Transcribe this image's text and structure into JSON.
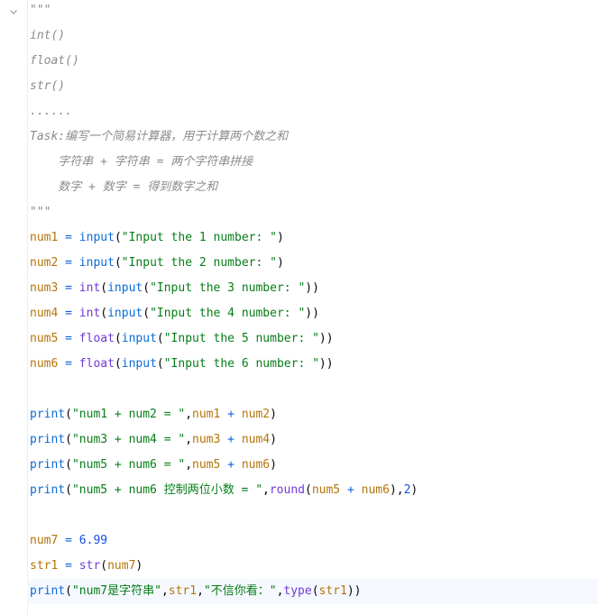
{
  "editor": {
    "lines": [
      {
        "tokens": [
          {
            "t": "\"\"\"",
            "c": "cmt"
          }
        ]
      },
      {
        "tokens": [
          {
            "t": "int()",
            "c": "cmt"
          }
        ]
      },
      {
        "tokens": [
          {
            "t": "float()",
            "c": "cmt"
          }
        ]
      },
      {
        "tokens": [
          {
            "t": "str()",
            "c": "cmt"
          }
        ]
      },
      {
        "tokens": [
          {
            "t": "......",
            "c": "cmt"
          }
        ]
      },
      {
        "tokens": [
          {
            "t": "Task:编写一个简易计算器，用于计算两个数之和",
            "c": "cmt"
          }
        ]
      },
      {
        "tokens": [
          {
            "t": "    字符串 + 字符串 = 两个字符串拼接",
            "c": "cmt"
          }
        ]
      },
      {
        "tokens": [
          {
            "t": "    数字 + 数字 = 得到数字之和",
            "c": "cmt"
          }
        ]
      },
      {
        "tokens": [
          {
            "t": "\"\"\"",
            "c": "cmt"
          }
        ]
      },
      {
        "tokens": [
          {
            "t": "num1",
            "c": "var"
          },
          {
            "t": " = ",
            "c": "op"
          },
          {
            "t": "input",
            "c": "bi"
          },
          {
            "t": "(",
            "c": "pun"
          },
          {
            "t": "\"Input the 1 number: \"",
            "c": "str"
          },
          {
            "t": ")",
            "c": "pun"
          }
        ]
      },
      {
        "tokens": [
          {
            "t": "num2",
            "c": "var"
          },
          {
            "t": " = ",
            "c": "op"
          },
          {
            "t": "input",
            "c": "bi"
          },
          {
            "t": "(",
            "c": "pun"
          },
          {
            "t": "\"Input the 2 number: \"",
            "c": "str"
          },
          {
            "t": ")",
            "c": "pun"
          }
        ]
      },
      {
        "tokens": [
          {
            "t": "num3",
            "c": "var"
          },
          {
            "t": " = ",
            "c": "op"
          },
          {
            "t": "int",
            "c": "fn"
          },
          {
            "t": "(",
            "c": "pun"
          },
          {
            "t": "input",
            "c": "bi"
          },
          {
            "t": "(",
            "c": "pun"
          },
          {
            "t": "\"Input the 3 number: \"",
            "c": "str"
          },
          {
            "t": "))",
            "c": "pun"
          }
        ]
      },
      {
        "tokens": [
          {
            "t": "num4",
            "c": "var"
          },
          {
            "t": " = ",
            "c": "op"
          },
          {
            "t": "int",
            "c": "fn"
          },
          {
            "t": "(",
            "c": "pun"
          },
          {
            "t": "input",
            "c": "bi"
          },
          {
            "t": "(",
            "c": "pun"
          },
          {
            "t": "\"Input the 4 number: \"",
            "c": "str"
          },
          {
            "t": "))",
            "c": "pun"
          }
        ]
      },
      {
        "tokens": [
          {
            "t": "num5",
            "c": "var"
          },
          {
            "t": " = ",
            "c": "op"
          },
          {
            "t": "float",
            "c": "fn"
          },
          {
            "t": "(",
            "c": "pun"
          },
          {
            "t": "input",
            "c": "bi"
          },
          {
            "t": "(",
            "c": "pun"
          },
          {
            "t": "\"Input the 5 number: \"",
            "c": "str"
          },
          {
            "t": "))",
            "c": "pun"
          }
        ]
      },
      {
        "tokens": [
          {
            "t": "num6",
            "c": "var"
          },
          {
            "t": " = ",
            "c": "op"
          },
          {
            "t": "float",
            "c": "fn"
          },
          {
            "t": "(",
            "c": "pun"
          },
          {
            "t": "input",
            "c": "bi"
          },
          {
            "t": "(",
            "c": "pun"
          },
          {
            "t": "\"Input the 6 number: \"",
            "c": "str"
          },
          {
            "t": "))",
            "c": "pun"
          }
        ]
      },
      {
        "tokens": []
      },
      {
        "tokens": [
          {
            "t": "print",
            "c": "kw-print"
          },
          {
            "t": "(",
            "c": "pun"
          },
          {
            "t": "\"num1 + num2 = \"",
            "c": "str"
          },
          {
            "t": ",",
            "c": "pun"
          },
          {
            "t": "num1",
            "c": "var"
          },
          {
            "t": " + ",
            "c": "op"
          },
          {
            "t": "num2",
            "c": "var"
          },
          {
            "t": ")",
            "c": "pun"
          }
        ]
      },
      {
        "tokens": [
          {
            "t": "print",
            "c": "kw-print"
          },
          {
            "t": "(",
            "c": "pun"
          },
          {
            "t": "\"num3 + num4 = \"",
            "c": "str"
          },
          {
            "t": ",",
            "c": "pun"
          },
          {
            "t": "num3",
            "c": "var"
          },
          {
            "t": " + ",
            "c": "op"
          },
          {
            "t": "num4",
            "c": "var"
          },
          {
            "t": ")",
            "c": "pun"
          }
        ]
      },
      {
        "tokens": [
          {
            "t": "print",
            "c": "kw-print"
          },
          {
            "t": "(",
            "c": "pun"
          },
          {
            "t": "\"num5 + num6 = \"",
            "c": "str"
          },
          {
            "t": ",",
            "c": "pun"
          },
          {
            "t": "num5",
            "c": "var"
          },
          {
            "t": " + ",
            "c": "op"
          },
          {
            "t": "num6",
            "c": "var"
          },
          {
            "t": ")",
            "c": "pun"
          }
        ]
      },
      {
        "tokens": [
          {
            "t": "print",
            "c": "kw-print"
          },
          {
            "t": "(",
            "c": "pun"
          },
          {
            "t": "\"num5 + num6 控制两位小数 = \"",
            "c": "str"
          },
          {
            "t": ",",
            "c": "pun"
          },
          {
            "t": "round",
            "c": "fn"
          },
          {
            "t": "(",
            "c": "pun"
          },
          {
            "t": "num5",
            "c": "var"
          },
          {
            "t": " + ",
            "c": "op"
          },
          {
            "t": "num6",
            "c": "var"
          },
          {
            "t": "),",
            "c": "pun"
          },
          {
            "t": "2",
            "c": "num"
          },
          {
            "t": ")",
            "c": "pun"
          }
        ]
      },
      {
        "tokens": []
      },
      {
        "tokens": [
          {
            "t": "num7",
            "c": "var"
          },
          {
            "t": " = ",
            "c": "op"
          },
          {
            "t": "6.99",
            "c": "num"
          }
        ]
      },
      {
        "tokens": [
          {
            "t": "str1",
            "c": "var"
          },
          {
            "t": " = ",
            "c": "op"
          },
          {
            "t": "str",
            "c": "fn"
          },
          {
            "t": "(",
            "c": "pun"
          },
          {
            "t": "num7",
            "c": "var"
          },
          {
            "t": ")",
            "c": "pun"
          }
        ]
      },
      {
        "tokens": [
          {
            "t": "print",
            "c": "kw-print"
          },
          {
            "t": "(",
            "c": "pun"
          },
          {
            "t": "\"num7是字符串\"",
            "c": "str"
          },
          {
            "t": ",",
            "c": "pun"
          },
          {
            "t": "str1",
            "c": "var"
          },
          {
            "t": ",",
            "c": "pun"
          },
          {
            "t": "\"不信你看：\"",
            "c": "str"
          },
          {
            "t": ",",
            "c": "pun"
          },
          {
            "t": "type",
            "c": "fn"
          },
          {
            "t": "(",
            "c": "pun"
          },
          {
            "t": "str1",
            "c": "var"
          },
          {
            "t": "))",
            "c": "pun"
          }
        ]
      }
    ],
    "current_line": 23
  },
  "icons": {
    "fold": "chevron-down-icon"
  },
  "colors": {
    "comment": "#8c8c8c",
    "variable": "#b5740a",
    "operator": "#0d5ce0",
    "builtin": "#0b6bd6",
    "function": "#6f3ad3",
    "string": "#067d17",
    "number": "#1750eb",
    "current_line_bg": "#f5f8fe"
  }
}
